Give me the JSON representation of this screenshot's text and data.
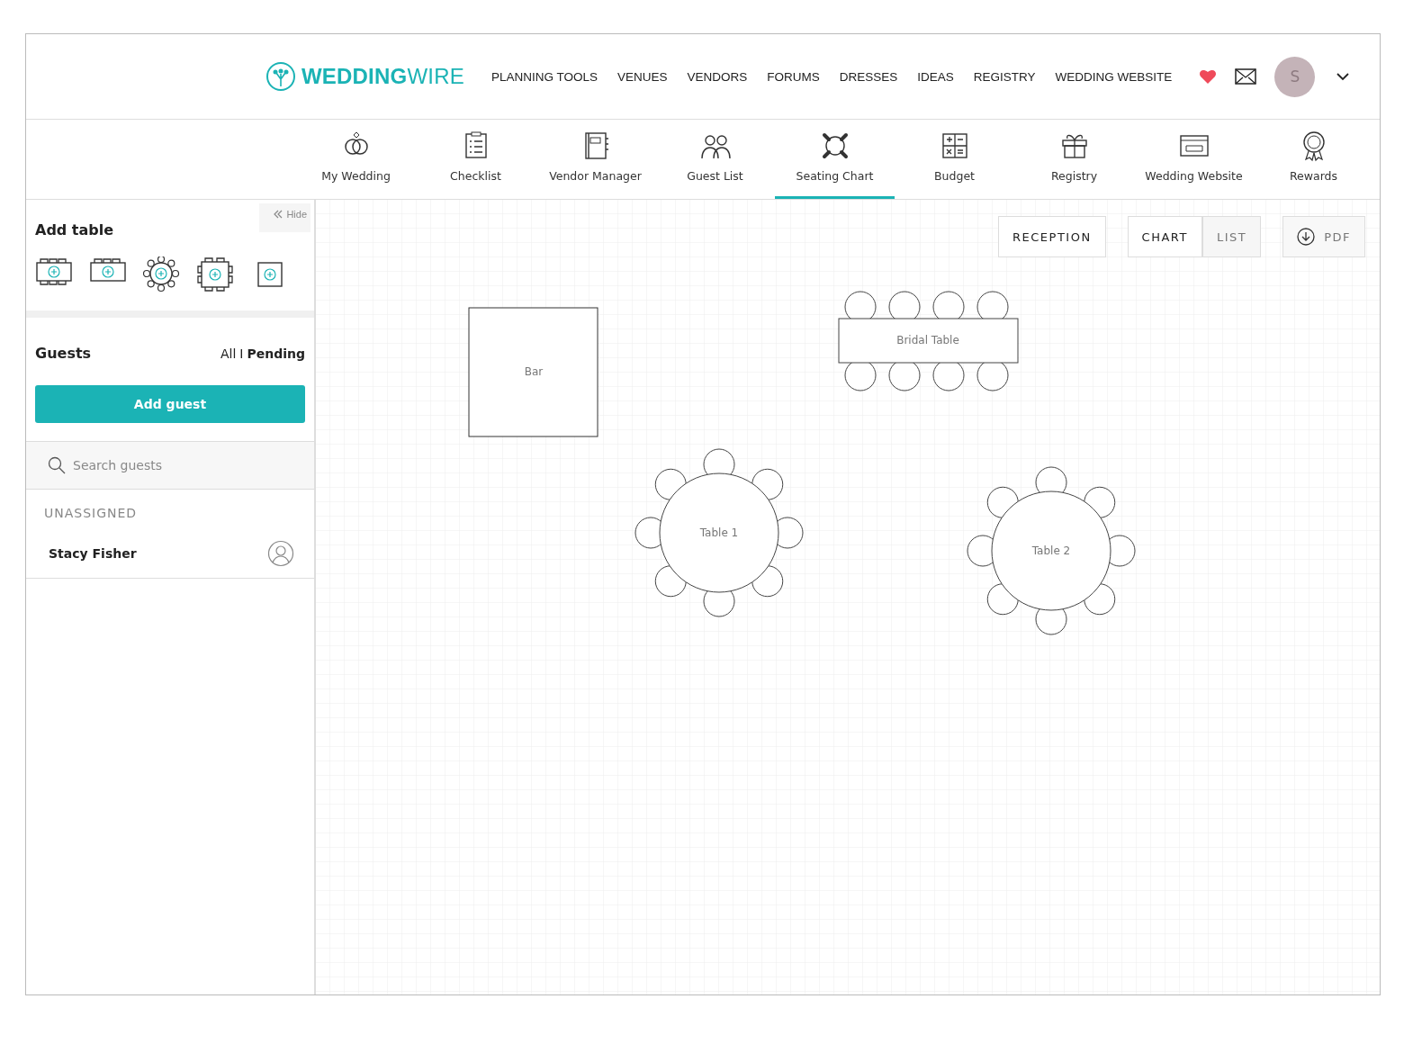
{
  "header": {
    "logo": {
      "bold": "WEDDING",
      "light": "WIRE"
    },
    "nav": [
      "PLANNING TOOLS",
      "VENUES",
      "VENDORS",
      "FORUMS",
      "DRESSES",
      "IDEAS",
      "REGISTRY",
      "WEDDING WEBSITE"
    ],
    "avatar": "S"
  },
  "tools": [
    {
      "kind": "rings",
      "label": "My Wedding",
      "selected": false
    },
    {
      "kind": "checklist",
      "label": "Checklist",
      "selected": false
    },
    {
      "kind": "notebook",
      "label": "Vendor Manager",
      "selected": false
    },
    {
      "kind": "people",
      "label": "Guest List",
      "selected": false
    },
    {
      "kind": "seating",
      "label": "Seating Chart",
      "selected": true
    },
    {
      "kind": "calculator",
      "label": "Budget",
      "selected": false
    },
    {
      "kind": "gift",
      "label": "Registry",
      "selected": false
    },
    {
      "kind": "browser",
      "label": "Wedding Website",
      "selected": false
    },
    {
      "kind": "medal",
      "label": "Rewards",
      "selected": false
    }
  ],
  "sidebar": {
    "hide": "Hide",
    "add_table_title": "Add table",
    "table_types": [
      {
        "kind": "banquet"
      },
      {
        "kind": "long"
      },
      {
        "kind": "round"
      },
      {
        "kind": "square"
      },
      {
        "kind": "single"
      }
    ],
    "guests_title": "Guests",
    "filter_all": "All",
    "filter_separator": "I",
    "filter_pending": "Pending",
    "add_guest": "Add guest",
    "search": {
      "placeholder": "Search guests"
    },
    "section": "UNASSIGNED",
    "guests": [
      "Stacy Fisher"
    ]
  },
  "toolbar": {
    "event": "RECEPTION",
    "views": [
      {
        "label": "CHART",
        "selected": true
      },
      {
        "label": "LIST",
        "selected": false
      }
    ],
    "export": "PDF"
  },
  "tables": [
    {
      "kind": "square",
      "label": "Bar"
    },
    {
      "kind": "banquet",
      "label": "Bridal Table"
    },
    {
      "kind": "round",
      "label": "Table 1"
    },
    {
      "kind": "round",
      "label": "Table 2"
    }
  ]
}
